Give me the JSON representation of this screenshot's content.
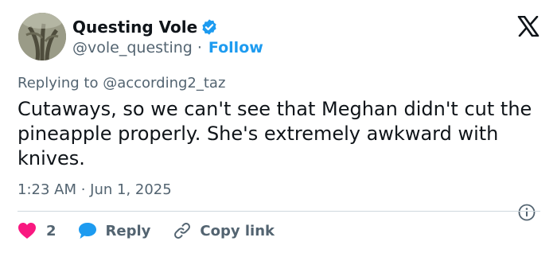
{
  "user": {
    "name": "Questing Vole",
    "handle": "@vole_questing",
    "separator": "·",
    "follow_label": "Follow"
  },
  "reply": {
    "prefix": "Replying to",
    "handle": "@according2_taz"
  },
  "tweet": {
    "text": "Cutaways, so we can't see that Meghan didn't cut the pineapple properly. She's extremely awkward with knives."
  },
  "meta": {
    "timestamp": "1:23 AM · Jun 1, 2025"
  },
  "actions": {
    "like_count": "2",
    "reply_label": "Reply",
    "copy_link_label": "Copy link"
  },
  "colors": {
    "accent": "#1d9bf0",
    "like": "#f91880",
    "text": "#0f1419",
    "muted": "#536471"
  },
  "icons": [
    "verified-badge-icon",
    "x-logo-icon",
    "info-icon",
    "heart-icon",
    "reply-bubble-icon",
    "link-icon"
  ]
}
